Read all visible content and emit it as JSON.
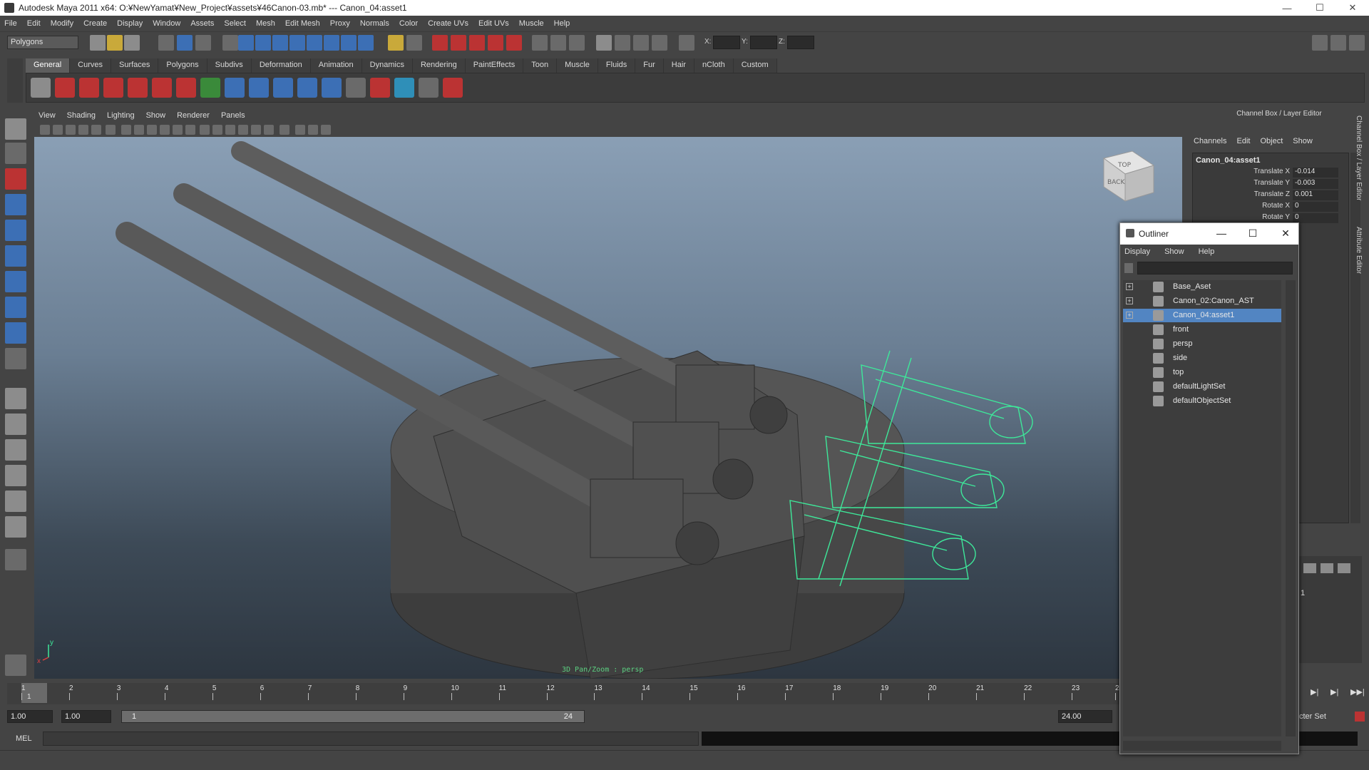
{
  "window": {
    "title": "Autodesk Maya 2011 x64: O:¥NewYamat¥New_Project¥assets¥46Canon-03.mb*  ---  Canon_04:asset1",
    "controls": [
      "—",
      "☐",
      "✕"
    ]
  },
  "menubar": [
    "File",
    "Edit",
    "Modify",
    "Create",
    "Display",
    "Window",
    "Assets",
    "Select",
    "Mesh",
    "Edit Mesh",
    "Proxy",
    "Normals",
    "Color",
    "Create UVs",
    "Edit UVs",
    "Muscle",
    "Help"
  ],
  "statusline": {
    "mode": "Polygons",
    "x_label": "X:",
    "y_label": "Y:",
    "z_label": "Z:"
  },
  "shelf": {
    "tabs": [
      "General",
      "Curves",
      "Surfaces",
      "Polygons",
      "Subdivs",
      "Deformation",
      "Animation",
      "Dynamics",
      "Rendering",
      "PaintEffects",
      "Toon",
      "Muscle",
      "Fluids",
      "Fur",
      "Hair",
      "nCloth",
      "Custom"
    ],
    "active_tab": "General"
  },
  "viewport": {
    "menu": [
      "View",
      "Shading",
      "Lighting",
      "Show",
      "Renderer",
      "Panels"
    ],
    "hud": "3D Pan/Zoom : persp",
    "viewcube_top": "TOP",
    "viewcube_side": "BACK",
    "axis_x": "x",
    "axis_y": "y",
    "wireframe_color": "#3ee89a",
    "mesh_color": "#5a5a5a"
  },
  "channelbox": {
    "title": "Channel Box / Layer Editor",
    "menu": [
      "Channels",
      "Edit",
      "Object",
      "Show"
    ],
    "object": "Canon_04:asset1",
    "channels": [
      {
        "label": "Translate X",
        "value": "-0.014"
      },
      {
        "label": "Translate Y",
        "value": "-0.003"
      },
      {
        "label": "Translate Z",
        "value": "0.001"
      },
      {
        "label": "Rotate X",
        "value": "0"
      },
      {
        "label": "Rotate Y",
        "value": "0"
      }
    ],
    "side_tabs": [
      "Channel Box / Layer Editor",
      "Attribute Editor"
    ]
  },
  "outliner": {
    "title": "Outliner",
    "menu": [
      "Display",
      "Show",
      "Help"
    ],
    "items": [
      {
        "label": "Base_Aset",
        "expand": "+",
        "selected": false
      },
      {
        "label": "Canon_02:Canon_AST",
        "expand": "+",
        "selected": false
      },
      {
        "label": "Canon_04:asset1",
        "expand": "+",
        "selected": true
      },
      {
        "label": "front",
        "expand": "",
        "selected": false
      },
      {
        "label": "persp",
        "expand": "",
        "selected": false
      },
      {
        "label": "side",
        "expand": "",
        "selected": false
      },
      {
        "label": "top",
        "expand": "",
        "selected": false
      },
      {
        "label": "defaultLightSet",
        "expand": "",
        "selected": false
      },
      {
        "label": "defaultObjectSet",
        "expand": "",
        "selected": false
      }
    ],
    "selection_color": "#5285c2"
  },
  "timeline": {
    "ticks": [
      "1",
      "2",
      "3",
      "4",
      "5",
      "6",
      "7",
      "8",
      "9",
      "10",
      "11",
      "12",
      "13",
      "14",
      "15",
      "16",
      "17",
      "18",
      "19",
      "20",
      "21",
      "22",
      "23",
      "24"
    ],
    "current_frame": "1"
  },
  "range": {
    "start": "1.00",
    "playback_start": "1.00",
    "slider_min": "1",
    "slider_max": "24",
    "end": "24.00",
    "character_set": "cter Set"
  },
  "cmdline": {
    "label": "MEL"
  },
  "right_panel": {
    "value": "1"
  }
}
